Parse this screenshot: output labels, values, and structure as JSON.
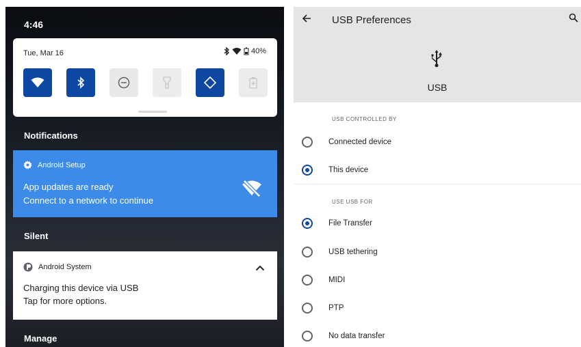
{
  "shade": {
    "time": "4:46",
    "quick_settings": {
      "date": "Tue, Mar 16",
      "battery_percent": "40%",
      "tiles": [
        {
          "name": "wifi",
          "state": "on"
        },
        {
          "name": "bluetooth",
          "state": "on"
        },
        {
          "name": "do-not-disturb",
          "state": "off"
        },
        {
          "name": "flashlight",
          "state": "disabled"
        },
        {
          "name": "auto-rotate",
          "state": "on"
        },
        {
          "name": "battery-saver",
          "state": "disabled"
        }
      ]
    },
    "notifications_label": "Notifications",
    "setup_notification": {
      "app": "Android Setup",
      "title": "App updates are ready",
      "text": "Connect to a network to continue"
    },
    "silent_label": "Silent",
    "system_notification": {
      "app": "Android System",
      "title": "Charging this device via USB",
      "text": "Tap for more options."
    },
    "manage_label": "Manage"
  },
  "usb_prefs": {
    "title": "USB Preferences",
    "header_label": "USB",
    "controlled_by": {
      "header": "USB CONTROLLED BY",
      "options": [
        {
          "label": "Connected device",
          "checked": false
        },
        {
          "label": "This device",
          "checked": true
        }
      ]
    },
    "use_for": {
      "header": "USE USB FOR",
      "options": [
        {
          "label": "File Transfer",
          "checked": true
        },
        {
          "label": "USB tethering",
          "checked": false
        },
        {
          "label": "MIDI",
          "checked": false
        },
        {
          "label": "PTP",
          "checked": false
        },
        {
          "label": "No data transfer",
          "checked": false
        }
      ]
    }
  },
  "colors": {
    "tile_on": "#0d47a1",
    "setup_card": "#3c8be8",
    "radio_checked": "#0d47a1",
    "appbar": "#e5e5e5"
  },
  "icons": {
    "back": "arrow-left-icon",
    "search": "search-icon",
    "usb": "usb-icon",
    "settings": "gear-icon",
    "wifi_off": "wifi-off-icon",
    "android_system": "android-system-icon",
    "chevron": "chevron-up-icon"
  }
}
